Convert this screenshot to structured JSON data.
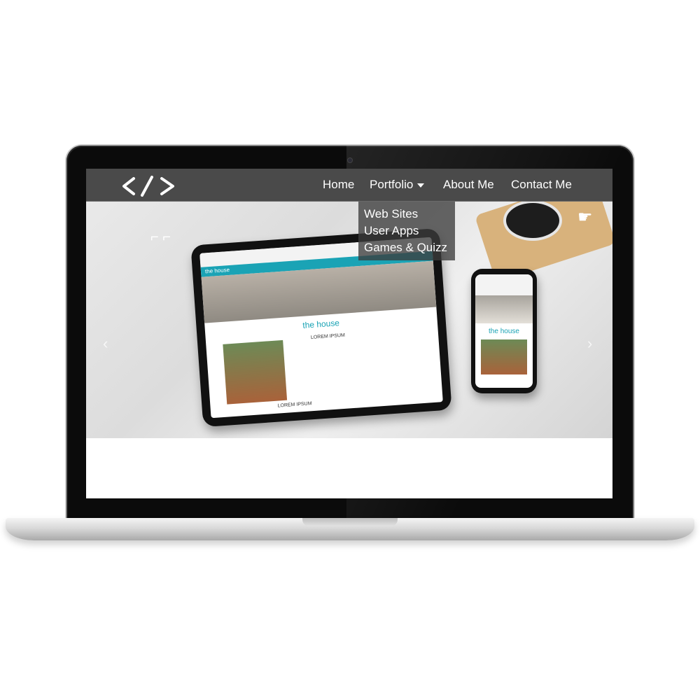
{
  "navbar": {
    "brand_icon": "code-brackets-icon",
    "links": {
      "home": "Home",
      "portfolio": "Portfolio",
      "about": "About Me",
      "contact": "Contact Me"
    },
    "portfolio_dropdown": {
      "items": [
        "Web Sites",
        "User Apps",
        "Games & Quizz"
      ]
    }
  },
  "hero": {
    "prev_arrow": "‹",
    "next_arrow": "›",
    "mockup": {
      "tablet_logo": "the house",
      "tablet_banner": "the house",
      "tablet_heading": "LOREM IPSUM",
      "tablet_footer_heading": "LOREM IPSUM",
      "phone_logo": "the house"
    },
    "hand_icon": "pointing-hand-icon"
  },
  "colors": {
    "navbar": "#4a4a4a",
    "accent_teal": "#1aa3b5"
  }
}
